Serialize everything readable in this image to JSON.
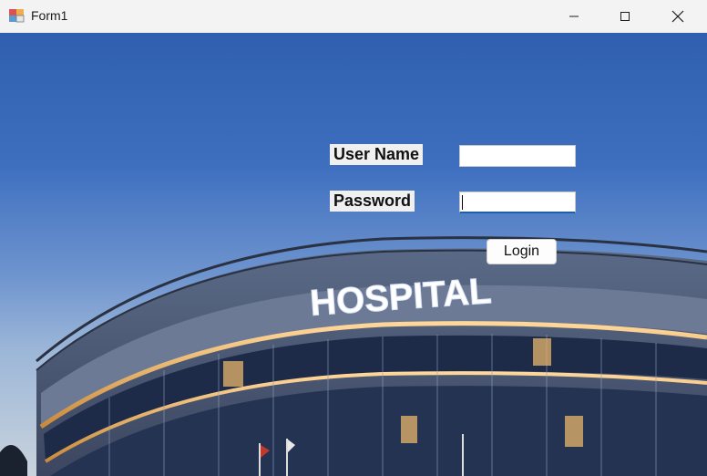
{
  "window": {
    "title": "Form1",
    "app_icon": "winforms-app-icon",
    "controls": [
      "minimize-icon",
      "maximize-icon",
      "close-icon"
    ]
  },
  "background": {
    "sign_text": "HOSPITAL"
  },
  "form": {
    "username_label": "User Name",
    "username_value": "",
    "password_label": "Password",
    "password_value": "",
    "login_label": "Login"
  }
}
